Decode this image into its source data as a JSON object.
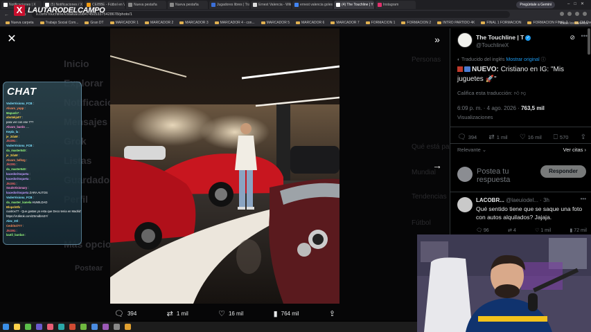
{
  "browser": {
    "tabs": [
      {
        "label": "Notificaciones | X",
        "color": "#ffffff",
        "active": false
      },
      {
        "label": "(5) Notificaciones / X",
        "color": "#ffffff",
        "active": false
      },
      {
        "label": "CEIBBE - Fútbol en Vi",
        "color": "#f39c12",
        "active": false
      },
      {
        "label": "Nueva pestaña",
        "color": "#888888",
        "active": false
      },
      {
        "label": "Nueva pestaña",
        "color": "#888888",
        "active": false
      },
      {
        "label": "Jugadores libres | Tra",
        "color": "#3b6fd8",
        "active": false
      },
      {
        "label": "Ernest Valencia - Wiki",
        "color": "#dddddd",
        "active": false
      },
      {
        "label": "ernest valencia goles",
        "color": "#4285f4",
        "active": false
      },
      {
        "label": "(4) The Touchline | Y",
        "color": "#ffffff",
        "active": true
      },
      {
        "label": "Instagram",
        "color": "#e1306c",
        "active": false
      }
    ],
    "gemini_label": "Pregúntale a Gemini",
    "url": "x.com/TouchlineX/status/2084745053375428678/photo/1",
    "bookmarks": [
      "Nueva carpeta",
      "Trabajo Social Com...",
      "Gran DT",
      "MARCADOR 1",
      "MARCADOR 2",
      "MARCADOR 3",
      "MARCADOR 4 - con...",
      "MARCADOR 5",
      "MARCADOR 6",
      "MARCADOR 7",
      "FORMACION 1",
      "FORMACION 2",
      "INTRO PARTIDO 4K",
      "FINAL 1 FORMACION",
      "FORMACION FINAL 2",
      "CM Overlay — Dash..."
    ],
    "all_bookmarks": "Todos los favoritos"
  },
  "logo_text": "LAUTARODELCAMPO",
  "background_ghost": {
    "items": [
      "Inicio",
      "Explorar",
      "Notificaciones",
      "Mensajes",
      "Grok",
      "Listas",
      "Guardados",
      "Perfil",
      "Más opciones",
      "Postear"
    ],
    "right_items": [
      "Personas",
      "Qué está pasando",
      "Mundial",
      "Tendencias",
      "Fútbol"
    ]
  },
  "chat": {
    "title": "CHAT",
    "lines": [
      {
        "user": "VoderVisionu_FCB",
        "msg": ":",
        "color": "#7fe3ff"
      },
      {
        "user": "Alvaro_yopp",
        "msg": ":",
        "color": "#ff8c5a"
      },
      {
        "user": "Mapusb7",
        "msg": ":",
        "color": "#9bff7f"
      },
      {
        "user": "abutakja07",
        "msg": ":",
        "color": "#ffd24a"
      },
      {
        "user": "",
        "msg": "para ver con ese 7??",
        "color": "#ffffff"
      },
      {
        "user": "Alvaro_bardo",
        "msg": "....",
        "color": "#ff8cd9"
      },
      {
        "user": "Kepla_la",
        "msg": ":",
        "color": "#7fe3ff"
      },
      {
        "user": "je_2daM",
        "msg": ":",
        "color": "#ffd24a"
      },
      {
        "user": "Jkr291",
        "msg": ":",
        "color": "#ff6b6b"
      },
      {
        "user": "VoderVisionu_FCB",
        "msg": ":",
        "color": "#7fe3ff"
      },
      {
        "user": "da_master540",
        "msg": ":",
        "color": "#9bff7f"
      },
      {
        "user": "je_2daM",
        "msg": ":",
        "color": "#ffd24a"
      },
      {
        "user": "Alvaro_bdhzg",
        "msg": ":",
        "color": "#ff8c5a"
      },
      {
        "user": "Jkr291",
        "msg": ":",
        "color": "#ff6b6b"
      },
      {
        "user": "da_master540",
        "msg": ":",
        "color": "#9bff7f"
      },
      {
        "user": "kacedoritoqueta",
        "msg": ":",
        "color": "#c39bff"
      },
      {
        "user": "kacedoritoqueta",
        "msg": ":",
        "color": "#c39bff"
      },
      {
        "user": "Jkr291",
        "msg": ":",
        "color": "#ff6b6b"
      },
      {
        "user": "SoulsVisionary",
        "msg": ":",
        "color": "#ff8cd9"
      },
      {
        "user": "kacedoritoqueta",
        "msg": "ZARA AUTOS",
        "color": "#c39bff"
      },
      {
        "user": "VoderVisionu_FCB",
        "msg": ":",
        "color": "#7fe3ff"
      },
      {
        "user": "da_master_kanela",
        "msg": "HUMILDAD",
        "color": "#9bff7f"
      },
      {
        "user": "Blopsh9fs",
        "msg": ":",
        "color": "#ffd24a"
      },
      {
        "user": "",
        "msg": "cuatrox77 - Que gastas yo esta que Deco tenia en Madrid?",
        "color": "#ffffff"
      },
      {
        "user": "",
        "msg": "https://vt.tiktok.com/ZSmdbm3Y/",
        "color": "#ffffff"
      },
      {
        "user": "Alex_20l",
        "msg": ":",
        "color": "#7fe3ff"
      },
      {
        "user": "Cedritol777",
        "msg": ":",
        "color": "#ff8c5a"
      },
      {
        "user": "Jkr291",
        "msg": ":",
        "color": "#ff6b6b"
      },
      {
        "user": "lautil_bardan",
        "msg": ":",
        "color": "#9bff7f"
      }
    ]
  },
  "viewer": {
    "close_icon": "close-icon",
    "expand_icon": "collapse-panel-icon",
    "next_icon": "arrow-right-icon",
    "stats": {
      "replies": "394",
      "reposts": "1 mil",
      "likes": "16 mil",
      "views": "764 mil"
    }
  },
  "tweet": {
    "author_name": "The Touchline | T",
    "author_handle": "@TouchlineX",
    "translated_label": "Traducido del inglés",
    "show_original": "Mostrar original",
    "text_prefix": "NUEVO:",
    "text_body": "Cristiano en IG: \"Mis juguetes 🚀\"",
    "rate_label": "Califica esta traducción:",
    "time": "6:09 p. m. · 4 ago. 2026 ·",
    "views_count": "763,5 mil",
    "views_label": "Visualizaciones",
    "actions": {
      "replies": "394",
      "reposts": "1 mil",
      "likes": "16 mil",
      "bookmarks": "570"
    },
    "sort_label": "Relevante",
    "see_quotes": "Ver citas",
    "reply_placeholder": "Postea tu respuesta",
    "reply_button": "Responder"
  },
  "comment": {
    "name": "LACOBR...",
    "handle": "@laeuiodel...",
    "time": "· 3h",
    "text": "Qué sentido tiene que se saque una foto con autos alquilados? Jajaja.",
    "replies": "96",
    "reposts": "4",
    "likes": "1 mil",
    "views": "72 mil"
  }
}
